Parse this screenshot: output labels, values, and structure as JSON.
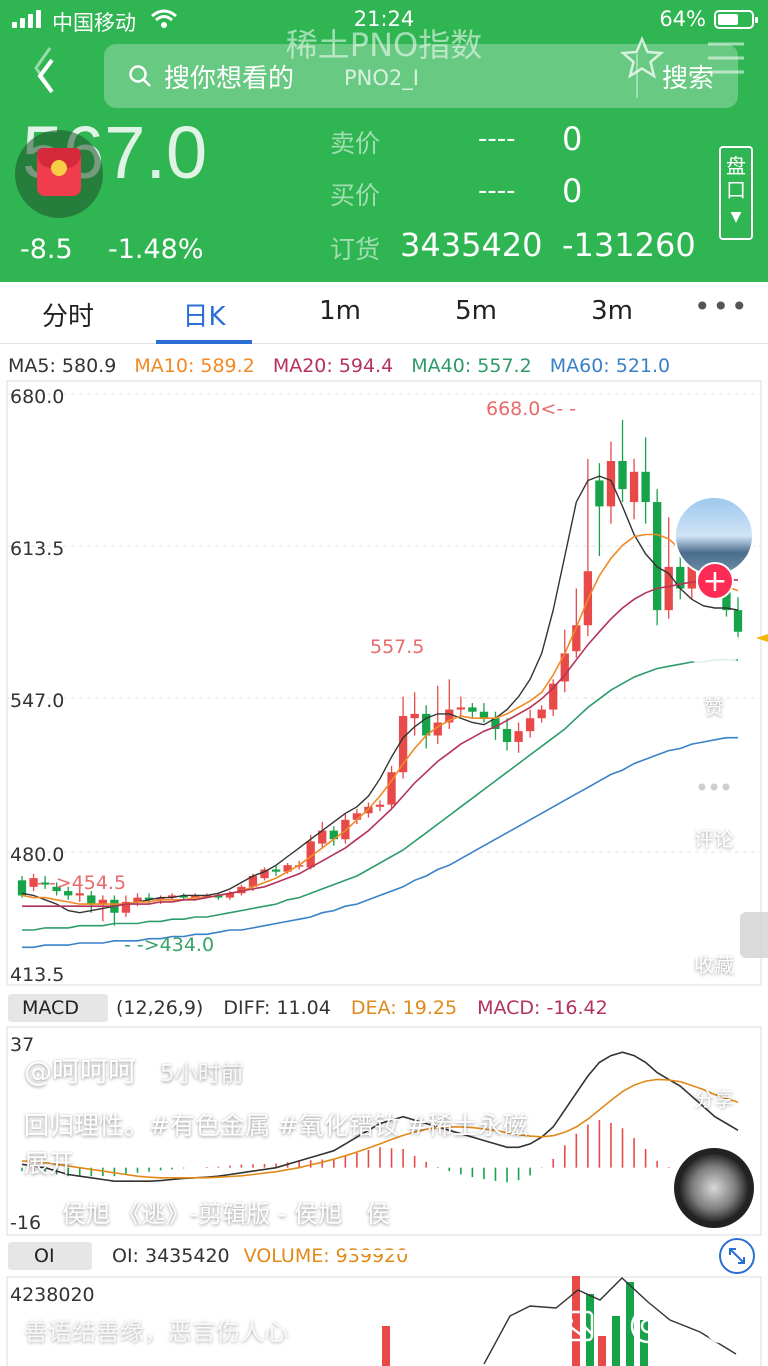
{
  "status_bar": {
    "carrier": "中国移动",
    "time": "21:24",
    "battery_pct": "64%",
    "battery_level": 0.64
  },
  "header": {
    "title": "稀土PNO指数",
    "search_placeholder": "搜你想看的",
    "search_sub": "PNO2_I",
    "search_button": "搜索",
    "price": "567.0",
    "change": "-8.5",
    "change_pct": "-1.48%",
    "ask_label": "卖价",
    "ask_price": "----",
    "ask_qty": "0",
    "bid_label": "买价",
    "bid_price": "----",
    "bid_qty": "0",
    "order_label": "订货",
    "order_volume": "3435420",
    "order_change": "-131260",
    "pankou_button": "盘口"
  },
  "tabs": [
    {
      "label": "分时",
      "active": false
    },
    {
      "label": "日K",
      "active": true
    },
    {
      "label": "1m",
      "active": false
    },
    {
      "label": "5m",
      "active": false
    },
    {
      "label": "3m",
      "active": false
    }
  ],
  "tabs_more": "•••",
  "ma_legend": {
    "ma5": "MA5: 580.9",
    "ma10": "MA10: 589.2",
    "ma20": "MA20: 594.4",
    "ma40": "MA40: 557.2",
    "ma60": "MA60: 521.0"
  },
  "colors": {
    "up": "#e84a4a",
    "down": "#16a34a",
    "ma5": "#333333",
    "ma10": "#f08a24",
    "ma20": "#b5325a",
    "ma40": "#2e9c6a",
    "ma60": "#3a82c8",
    "header_green": "#2fb552",
    "accent": "#2b6fd6"
  },
  "chart_data": [
    {
      "type": "candlestick",
      "title": "日K",
      "y_ticks": [
        "680.0",
        "613.5",
        "547.0",
        "480.0",
        "413.5"
      ],
      "ylim": [
        413.5,
        680.0
      ],
      "annotations": {
        "high": "668.0<- -",
        "mid_high": "557.5",
        "low_left": "- ->454.5",
        "low": "- ->434.0"
      },
      "candles": [
        [
          452,
          455,
          448,
          447,
          457
        ],
        [
          451,
          452,
          456,
          450,
          458
        ],
        [
          455,
          454,
          453,
          451,
          457
        ],
        [
          452,
          452,
          450,
          448,
          454
        ],
        [
          450,
          450,
          448,
          446,
          452
        ],
        [
          449,
          448,
          449,
          445,
          452
        ],
        [
          447,
          448,
          444,
          440,
          450
        ],
        [
          444,
          444,
          446,
          436,
          448
        ],
        [
          443,
          446,
          440,
          434,
          448
        ],
        [
          441,
          440,
          445,
          438,
          448
        ],
        [
          445,
          445,
          447,
          443,
          449
        ],
        [
          447,
          447,
          446,
          444,
          449
        ],
        [
          446,
          446,
          447,
          444,
          448
        ],
        [
          447,
          447,
          448,
          446,
          449
        ],
        [
          448,
          448,
          447,
          446,
          449
        ],
        [
          447,
          447,
          448,
          446,
          449
        ],
        [
          448,
          448,
          448,
          447,
          449
        ],
        [
          448,
          448,
          447,
          446,
          449
        ],
        [
          447,
          447,
          449,
          446,
          450
        ],
        [
          449,
          449,
          452,
          448,
          453
        ],
        [
          452,
          452,
          457,
          450,
          458
        ],
        [
          457,
          456,
          460,
          455,
          461
        ],
        [
          460,
          460,
          459,
          457,
          462
        ],
        [
          459,
          459,
          462,
          458,
          463
        ],
        [
          461,
          462,
          462,
          460,
          464
        ],
        [
          462,
          461,
          473,
          460,
          476
        ],
        [
          473,
          472,
          478,
          470,
          482
        ],
        [
          477,
          478,
          474,
          471,
          480
        ],
        [
          475,
          474,
          483,
          472,
          486
        ],
        [
          483,
          483,
          486,
          481,
          488
        ],
        [
          486,
          486,
          489,
          484,
          491
        ],
        [
          489,
          489,
          490,
          487,
          492
        ],
        [
          490,
          490,
          505,
          488,
          508
        ],
        [
          506,
          505,
          531,
          502,
          540
        ],
        [
          530,
          530,
          532,
          522,
          542
        ],
        [
          532,
          532,
          522,
          516,
          536
        ],
        [
          522,
          522,
          528,
          518,
          545
        ],
        [
          528,
          528,
          534,
          525,
          548
        ],
        [
          534,
          534,
          535,
          531,
          540
        ],
        [
          535,
          535,
          533,
          530,
          537
        ],
        [
          533,
          533,
          530,
          528,
          537
        ],
        [
          530,
          530,
          525,
          520,
          533
        ],
        [
          525,
          525,
          519,
          515,
          530
        ],
        [
          519,
          519,
          524,
          514,
          528
        ],
        [
          524,
          524,
          530,
          521,
          534
        ],
        [
          530,
          530,
          534,
          528,
          536
        ],
        [
          534,
          534,
          546,
          531,
          548
        ],
        [
          547,
          547,
          560,
          542,
          571
        ],
        [
          561,
          561,
          573,
          558,
          590
        ],
        [
          573,
          573,
          598,
          568,
          650
        ],
        [
          640,
          640,
          628,
          605,
          648
        ],
        [
          628,
          628,
          649,
          620,
          658
        ],
        [
          649,
          649,
          636,
          630,
          668
        ],
        [
          630,
          630,
          644,
          622,
          650
        ],
        [
          644,
          644,
          630,
          620,
          660
        ],
        [
          630,
          630,
          580,
          573,
          636
        ],
        [
          580,
          580,
          600,
          576,
          623
        ],
        [
          600,
          600,
          590,
          585,
          610
        ],
        [
          590,
          590,
          611,
          585,
          615
        ],
        [
          611,
          611,
          606,
          602,
          614
        ],
        [
          606,
          606,
          595,
          590,
          614
        ],
        [
          595,
          595,
          580,
          577,
          600
        ],
        [
          580,
          580,
          570,
          566,
          586
        ]
      ],
      "ma_series": [
        {
          "name": "MA5",
          "values": [
            449,
            448,
            446,
            444,
            441,
            440,
            441,
            442,
            443,
            444,
            445,
            446,
            447,
            447,
            448,
            448,
            448,
            449,
            451,
            454,
            457,
            459,
            462,
            466,
            470,
            474,
            478,
            482,
            486,
            489,
            494,
            502,
            512,
            521,
            526,
            530,
            532,
            532,
            530,
            528,
            527,
            530,
            534,
            540,
            548,
            560,
            580,
            605,
            630,
            640,
            642,
            640,
            628,
            615,
            606,
            600,
            597,
            590,
            585,
            582,
            581,
            581,
            580
          ]
        },
        {
          "name": "MA10",
          "values": [
            448,
            447,
            447,
            446,
            445,
            444,
            444,
            444,
            444,
            444,
            445,
            445,
            446,
            446,
            446,
            447,
            447,
            448,
            449,
            450,
            452,
            454,
            456,
            459,
            462,
            466,
            470,
            474,
            478,
            483,
            488,
            494,
            501,
            509,
            516,
            522,
            526,
            529,
            531,
            530,
            530,
            530,
            532,
            535,
            538,
            542,
            550,
            560,
            572,
            585,
            596,
            604,
            610,
            614,
            615,
            615,
            613,
            608,
            603,
            598,
            594,
            591,
            589
          ]
        },
        {
          "name": "MA20",
          "values": [
            443,
            443,
            443,
            443,
            443,
            443,
            443,
            443,
            443,
            444,
            444,
            444,
            445,
            445,
            446,
            446,
            447,
            448,
            449,
            450,
            451,
            452,
            454,
            456,
            458,
            461,
            464,
            467,
            470,
            474,
            478,
            483,
            488,
            494,
            500,
            505,
            510,
            514,
            518,
            521,
            524,
            526,
            529,
            532,
            535,
            539,
            544,
            550,
            557,
            564,
            570,
            576,
            581,
            585,
            588,
            590,
            591,
            592,
            593,
            593,
            594,
            594,
            594
          ]
        },
        {
          "name": "MA40",
          "values": [
            432,
            432,
            433,
            433,
            433,
            434,
            434,
            434,
            435,
            435,
            435,
            436,
            436,
            437,
            437,
            438,
            438,
            439,
            440,
            441,
            442,
            443,
            444,
            446,
            447,
            449,
            451,
            453,
            455,
            457,
            460,
            463,
            466,
            469,
            473,
            477,
            481,
            485,
            489,
            493,
            497,
            501,
            505,
            509,
            513,
            517,
            521,
            525,
            530,
            535,
            539,
            543,
            546,
            549,
            551,
            553,
            554,
            555,
            556,
            556,
            557,
            557,
            557
          ]
        },
        {
          "name": "MA60",
          "values": [
            424,
            424,
            425,
            425,
            425,
            426,
            426,
            426,
            427,
            427,
            427,
            428,
            428,
            429,
            429,
            430,
            430,
            431,
            432,
            432,
            433,
            434,
            435,
            436,
            437,
            438,
            440,
            441,
            443,
            444,
            446,
            448,
            450,
            452,
            455,
            457,
            460,
            462,
            465,
            468,
            471,
            474,
            477,
            480,
            483,
            486,
            489,
            492,
            495,
            498,
            501,
            504,
            506,
            509,
            511,
            513,
            515,
            516,
            518,
            519,
            520,
            521,
            521
          ]
        }
      ]
    },
    {
      "type": "bar",
      "title": "MACD",
      "y_ticks": [
        "37",
        "-16"
      ],
      "ylim": [
        -16,
        37
      ],
      "series": [
        {
          "name": "DIFF",
          "values": [
            1,
            0.5,
            0,
            -1,
            -2,
            -2.5,
            -3,
            -3.5,
            -4,
            -4,
            -4,
            -4,
            -3.8,
            -3.5,
            -3.2,
            -3,
            -2.8,
            -2.5,
            -2,
            -1.5,
            -1,
            -0.5,
            0,
            1,
            2,
            3,
            4,
            5,
            7,
            9,
            11,
            13,
            14,
            15,
            14,
            13,
            12,
            11,
            10,
            9,
            8,
            7,
            6,
            6,
            7,
            9,
            12,
            17,
            22,
            27,
            31,
            33,
            34,
            33,
            31,
            28,
            26,
            24,
            21,
            18,
            15,
            13,
            11
          ]
        },
        {
          "name": "DEA",
          "values": [
            2,
            1.8,
            1.5,
            1,
            0.5,
            0,
            -0.5,
            -1,
            -1.5,
            -2,
            -2.5,
            -2.8,
            -3,
            -3,
            -3,
            -3,
            -3,
            -2.8,
            -2.6,
            -2.4,
            -2,
            -1.6,
            -1.2,
            -0.6,
            0,
            0.8,
            1.6,
            2.5,
            3.5,
            4.6,
            5.8,
            7,
            8.3,
            9.5,
            10.5,
            11.3,
            11.8,
            12,
            12,
            11.8,
            11.4,
            10.9,
            10.3,
            9.7,
            9.3,
            9.1,
            9.4,
            10.4,
            12,
            14.3,
            17,
            19.8,
            22.4,
            24.3,
            25.5,
            26,
            25.8,
            25.3,
            24.2,
            23,
            21.5,
            20.3,
            19.3
          ]
        }
      ],
      "values": [
        -1,
        -1,
        -1.5,
        -2,
        -2.5,
        -2.5,
        -2.5,
        -2.5,
        -2.5,
        -2,
        -1.5,
        -1.2,
        -0.8,
        -0.5,
        -0.2,
        0,
        0.2,
        0.3,
        0.6,
        0.9,
        1,
        1.1,
        1.2,
        1.6,
        2,
        2.2,
        2.4,
        2.5,
        3.5,
        4.4,
        5.2,
        6,
        5.7,
        5.5,
        3.5,
        1.7,
        0.2,
        -1,
        -2,
        -2.8,
        -3.4,
        -3.9,
        -4.3,
        -3.7,
        -2.3,
        -0.1,
        2.6,
        6.6,
        10,
        12.7,
        14,
        13.2,
        11.6,
        8.7,
        5.5,
        2,
        0.2,
        -1.3,
        -3.2,
        -5,
        -6.5,
        -7.3,
        -8.3
      ],
      "diff": "DIFF: 11.04",
      "dea": "DEA: 19.25",
      "macd": "MACD: -16.42",
      "params": "(12,26,9)"
    },
    {
      "type": "bar",
      "title": "OI",
      "y_ticks": [
        "4238020"
      ],
      "oi": "OI: 3435420",
      "volume": "VOLUME: 939920"
    }
  ],
  "overlay": {
    "author": "@呵呵呵",
    "time": "5小时前",
    "caption": "回归理性。#有色金属 #氧化镨钕 #稀土永磁",
    "expand": "展开",
    "music": "侯旭 《逃》-剪辑版 - 侯旭　侯",
    "comment_placeholder": "善语结善缘，恶言伤人心",
    "like_label": "赞",
    "comment_label": "评论",
    "favorite_label": "收藏",
    "share_label": "分享",
    "video_progress": 0.43
  }
}
